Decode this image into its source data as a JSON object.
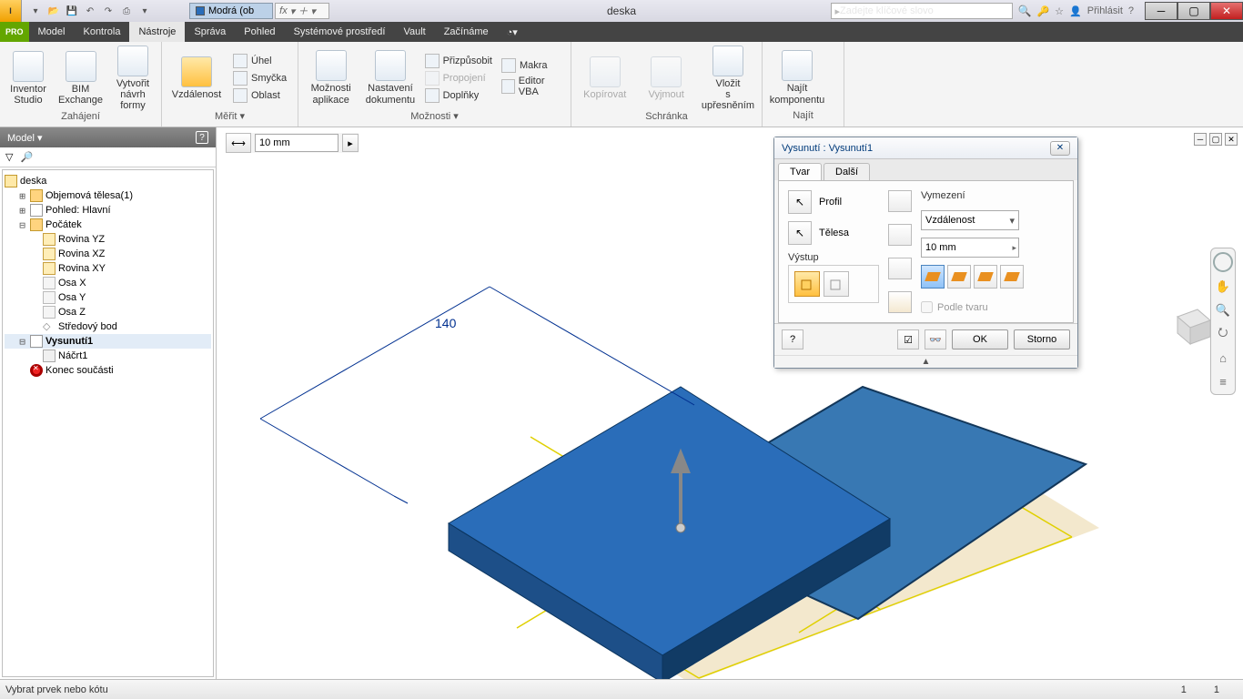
{
  "title": "deska",
  "appearance_tab": "Modrá (ob",
  "fx_label": "fx",
  "search_placeholder": "Zadejte klíčové slovo",
  "login_label": "Přihlásit",
  "pro_badge": "PRO",
  "menu": {
    "model": "Model",
    "kontrola": "Kontrola",
    "nastroje": "Nástroje",
    "sprava": "Správa",
    "pohled": "Pohled",
    "sysprostredi": "Systémové prostředí",
    "vault": "Vault",
    "zaciname": "Začínáme"
  },
  "ribbon": {
    "zahajeni": {
      "title": "Zahájení",
      "inventor_studio": "Inventor\nStudio",
      "bim_exchange": "BIM\nExchange",
      "vytvorit_navrh": "Vytvořit\nnávrh formy"
    },
    "merit": {
      "title": "Měřit ▾",
      "vzdalenost": "Vzdálenost",
      "uhel": "Úhel",
      "smycka": "Smyčka",
      "oblast": "Oblast"
    },
    "moznosti": {
      "title": "Možnosti ▾",
      "moznosti_aplikace": "Možnosti\naplikace",
      "nastaveni_dokumentu": "Nastavení\ndokumentu",
      "prizpusobit": "Přizpůsobit",
      "propojeni": "Propojení",
      "doplnky": "Doplňky",
      "makra": "Makra",
      "editor_vba": "Editor VBA"
    },
    "schranka": {
      "title": "Schránka",
      "kopirovat": "Kopírovat",
      "vyjmout": "Vyjmout",
      "vlozit": "Vložit\ns upřesněním"
    },
    "najit": {
      "title": "Najít",
      "najit_komponentu": "Najít\nkomponentu"
    }
  },
  "measure_value": "10 mm",
  "model_panel": {
    "title": "Model ▾",
    "root": "deska",
    "solids": "Objemová tělesa(1)",
    "view": "Pohled: Hlavní",
    "origin": "Počátek",
    "yz": "Rovina YZ",
    "xz": "Rovina XZ",
    "xy": "Rovina XY",
    "ox": "Osa X",
    "oy": "Osa Y",
    "oz": "Osa Z",
    "center": "Středový bod",
    "extrusion": "Vysunutí1",
    "sketch": "Náčrt1",
    "end": "Konec součásti"
  },
  "dimension": "140",
  "dialog": {
    "title": "Vysunutí : Vysunutí1",
    "tab_tvar": "Tvar",
    "tab_dalsi": "Další",
    "profil": "Profil",
    "telesa": "Tělesa",
    "vystup": "Výstup",
    "vymezeni": "Vymezení",
    "vzdalenost": "Vzdálenost",
    "distance": "10 mm",
    "podle_tvaru": "Podle tvaru",
    "ok": "OK",
    "storno": "Storno"
  },
  "status": {
    "prompt": "Vybrat prvek nebo kótu",
    "n1": "1",
    "n2": "1"
  }
}
